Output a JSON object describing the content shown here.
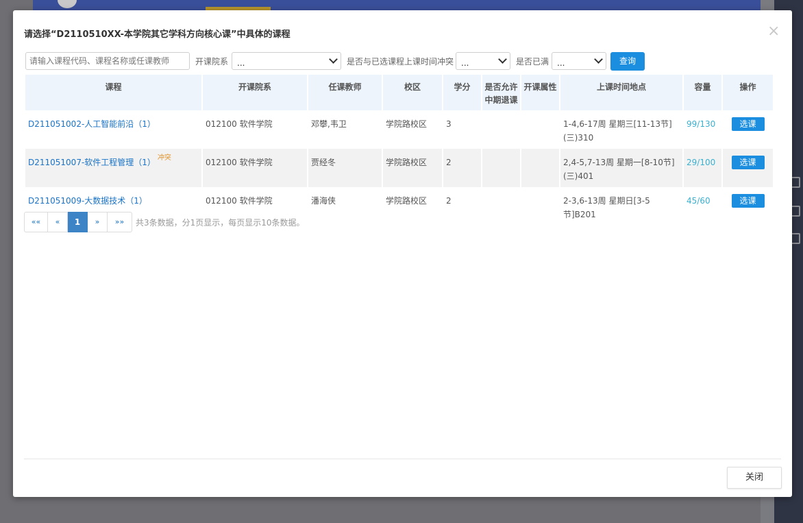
{
  "dialog": {
    "title": "请选择“D2110510XX-本学院其它学科方向核心课”中具体的课程",
    "close_label": "关闭"
  },
  "filters": {
    "search_placeholder": "请输入课程代码、课程名称或任课教师",
    "dept_label": "开课院系",
    "dept_value": "...",
    "conflict_label": "是否与已选课程上课时间冲突",
    "conflict_value": "...",
    "full_label": "是否已满",
    "full_value": "...",
    "query_label": "查询"
  },
  "table": {
    "headers": [
      "课程",
      "开课院系",
      "任课教师",
      "校区",
      "学分",
      "是否允许中期退课",
      "开课属性",
      "上课时间地点",
      "容量",
      "操作"
    ],
    "rows": [
      {
        "course": "D211051002-人工智能前沿（1）",
        "conflict": "",
        "dept": "012100 软件学院",
        "teacher": "邓攀,韦卫",
        "campus": "学院路校区",
        "credit": "3",
        "withdraw": "",
        "attr": "",
        "time": "1-4,6-17周 星期三[11-13节](三)310",
        "capacity": "99/130",
        "action": "选课"
      },
      {
        "course": "D211051007-软件工程管理（1）",
        "conflict": "冲突",
        "dept": "012100 软件学院",
        "teacher": "贾经冬",
        "campus": "学院路校区",
        "credit": "2",
        "withdraw": "",
        "attr": "",
        "time": "2,4-5,7-13周 星期一[8-10节](三)401",
        "capacity": "29/100",
        "action": "选课"
      },
      {
        "course": "D211051009-大数据技术（1）",
        "conflict": "",
        "dept": "012100 软件学院",
        "teacher": "潘海侠",
        "campus": "学院路校区",
        "credit": "2",
        "withdraw": "",
        "attr": "",
        "time": "2-3,6-13周 星期日[3-5节]B201",
        "capacity": "45/60",
        "action": "选课"
      }
    ]
  },
  "pagination": {
    "first": "««",
    "prev": "«",
    "current": "1",
    "next": "»",
    "last": "»»",
    "info": "共3条数据，分1页显示，每页显示10条数据。"
  }
}
